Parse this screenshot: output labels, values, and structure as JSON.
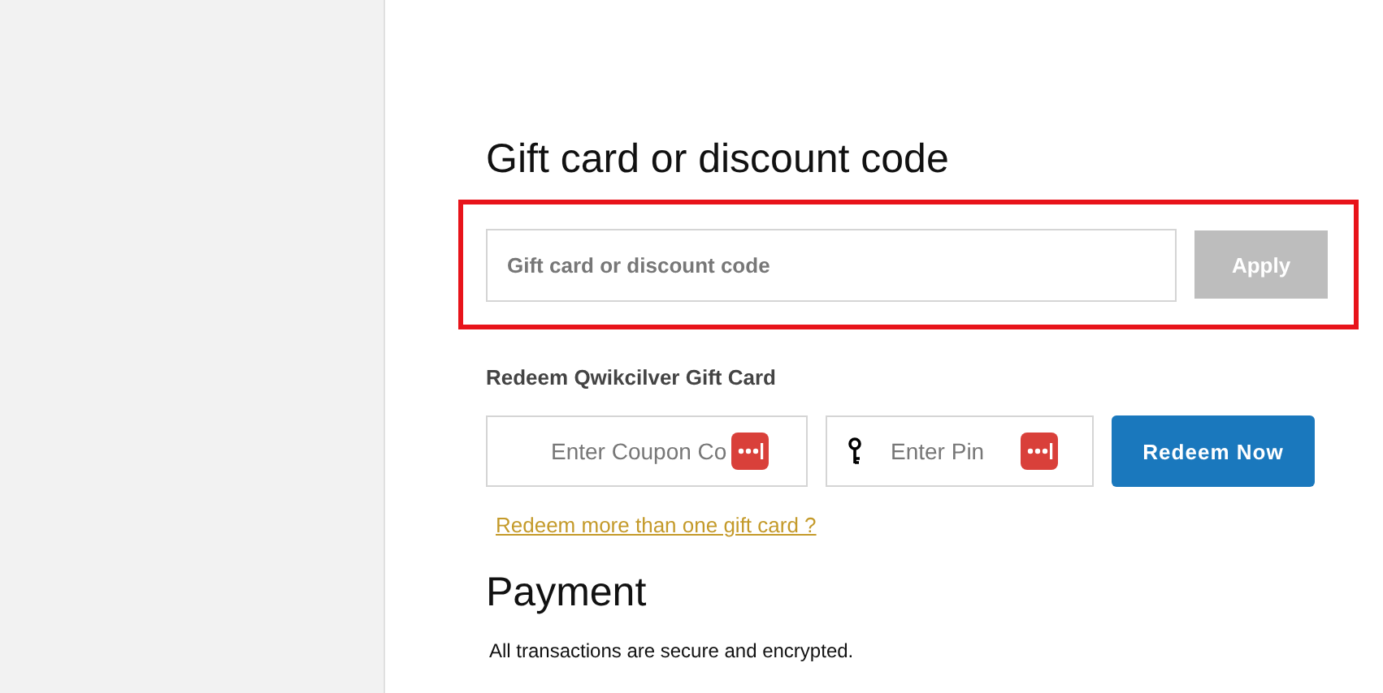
{
  "discount": {
    "title": "Gift card or discount code",
    "highlighted": true,
    "placeholder": "Gift card or discount code",
    "apply": {
      "label": "Apply",
      "disabled": true
    }
  },
  "gift_card": {
    "title": "Redeem Qwikcilver Gift Card",
    "coupon_placeholder": "Enter Coupon Co",
    "pin_placeholder": "Enter Pin",
    "redeem": "Redeem Now",
    "more_link": "Redeem more than one gift card ?"
  },
  "payment": {
    "title": "Payment",
    "note": "All transactions are secure and encrypted."
  }
}
